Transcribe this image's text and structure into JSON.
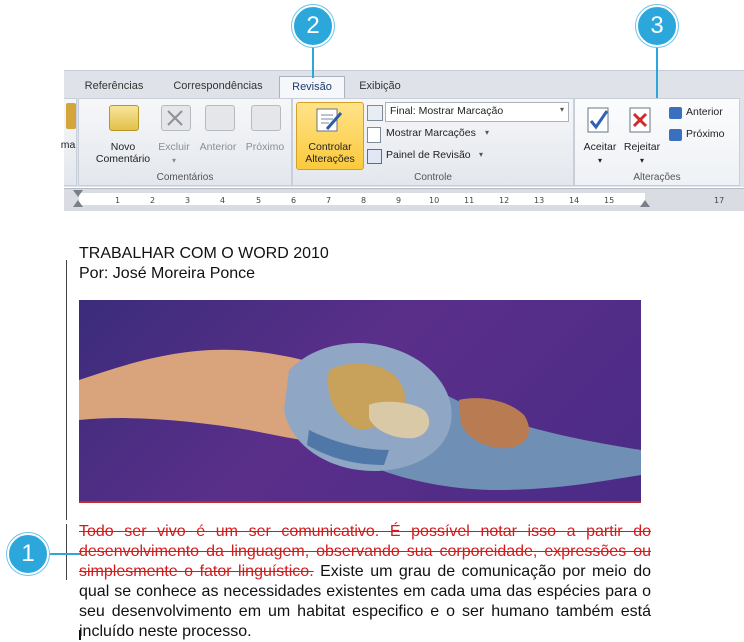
{
  "ribbon": {
    "tabs": [
      "Referências",
      "Correspondências",
      "Revisão",
      "Exibição"
    ],
    "active_tab": "Revisão",
    "left_cut_label": "ma",
    "comentarios_group": {
      "label": "Comentários",
      "novo": "Novo\nComentário",
      "excluir": "Excluir",
      "anterior": "Anterior",
      "proximo": "Próximo"
    },
    "controle_group": {
      "label": "Controle",
      "controlar": "Controlar\nAlterações",
      "final_select": "Final: Mostrar Marcação",
      "mostrar_marcacoes": "Mostrar Marcações",
      "painel_revisao": "Painel de Revisão"
    },
    "alteracoes_group": {
      "label": "Alterações",
      "aceitar": "Aceitar",
      "rejeitar": "Rejeitar",
      "anterior": "Anterior",
      "proximo": "Próximo"
    }
  },
  "ruler": {
    "ticks": [
      "1",
      "2",
      "3",
      "4",
      "5",
      "6",
      "7",
      "8",
      "9",
      "10",
      "11",
      "12",
      "13",
      "14",
      "15",
      "17"
    ]
  },
  "document": {
    "title": "TRABALHAR COM O WORD 2010",
    "author": "Por: José Moreira Ponce",
    "deleted_text": "Todo ser vivo é um ser comunicativo. É possível notar isso a partir do desenvolvimento da linguagem, observando sua corporeidade, expressões ou simplesmente o fator linguístico.",
    "body_text": " Existe um grau de comunicação por meio do qual se conhece as necessidades existentes em cada uma das espécies para o seu desenvolvimento em um habitat especifico e o ser humano também está incluído neste processo."
  },
  "callouts": [
    "1",
    "2",
    "3"
  ]
}
